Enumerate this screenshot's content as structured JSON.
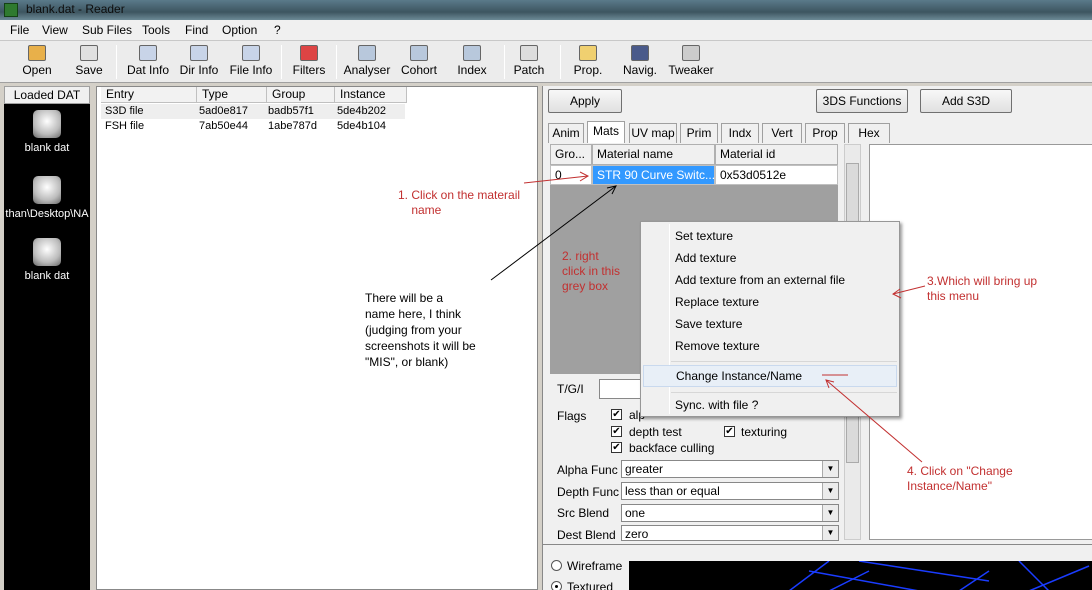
{
  "window": {
    "title": "blank.dat - Reader"
  },
  "menu": [
    "File",
    "View",
    "Sub Files",
    "Tools",
    "Find",
    "Option",
    "?"
  ],
  "toolbar": [
    "Open",
    "Save",
    "Dat Info",
    "Dir Info",
    "File Info",
    "Filters",
    "Analyser",
    "Cohort",
    "Index",
    "Patch",
    "Prop.",
    "Navig.",
    "Tweaker"
  ],
  "left_panel": {
    "header": "Loaded DAT",
    "items": [
      "blank dat",
      "than\\Desktop\\NA",
      "blank dat"
    ]
  },
  "file_list": {
    "columns": [
      "Entry",
      "Type",
      "Group",
      "Instance"
    ],
    "rows": [
      [
        "S3D file",
        "5ad0e817",
        "badb57f1",
        "5de4b202"
      ],
      [
        "FSH file",
        "7ab50e44",
        "1abe787d",
        "5de4b104"
      ]
    ]
  },
  "right_panel": {
    "apply_button": "Apply",
    "functions_button": "3DS Functions",
    "add_button": "Add S3D",
    "tabs": [
      "Anim",
      "Mats",
      "UV map",
      "Prim",
      "Indx",
      "Vert",
      "Prop",
      "Hex"
    ],
    "active_tab": "Mats",
    "grid_columns": [
      "Gro...",
      "Material name",
      "Material id"
    ],
    "grid_row": [
      "0",
      "STR 90 Curve Switc...",
      "0x53d0512e"
    ],
    "tgi_label": "T/G/I",
    "flags_label": "Flags",
    "flags": {
      "alpha_partial": "alp",
      "depth_test": "depth test",
      "texturing": "texturing",
      "backface_culling": "backface culling"
    },
    "check_mark": "✔",
    "selects": [
      {
        "label": "Alpha Func",
        "value": "greater"
      },
      {
        "label": "Depth Func",
        "value": "less than or equal"
      },
      {
        "label": "Src Blend",
        "value": "one"
      },
      {
        "label": "Dest Blend",
        "value": "zero"
      }
    ],
    "render_modes": [
      "Wireframe",
      "Textured"
    ]
  },
  "context_menu": [
    "Set texture",
    "Add texture",
    "Add texture from an external file",
    "Replace texture",
    "Save texture",
    "Remove texture",
    "Change Instance/Name",
    "Sync. with file ?"
  ],
  "annotations": {
    "step1": "1. Click on the materail\n    name",
    "step2": "2. right\nclick in this\ngrey box",
    "step3": "3.Which will bring up\nthis menu",
    "step4": "4. Click on \"Change\nInstance/Name\"",
    "note": "There will be a\nname here, I think\n(judging from your\nscreenshots it will be\n\"MIS\", or blank)"
  },
  "colors": {
    "annotation_red": "#c23030",
    "selection_blue": "#3399ff",
    "grid_grey": "#a0a0a0"
  }
}
